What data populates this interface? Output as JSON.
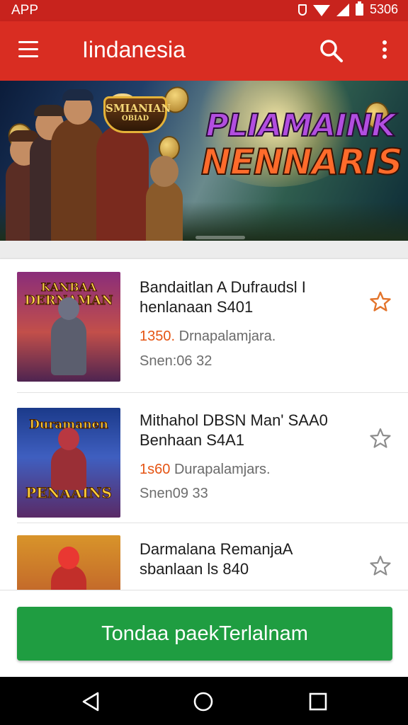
{
  "status_bar": {
    "app_label": "APP",
    "time": "5306"
  },
  "app_bar": {
    "title": "Iindanesia",
    "menu_icon": "hamburger-menu-icon",
    "search_icon": "search-icon",
    "more_icon": "more-vert-icon"
  },
  "banner": {
    "logo_line1": "SMIANIAN",
    "logo_line2": "OBIAD",
    "title_line1": "PLIAMAINK",
    "title_line2": "NENNARIS"
  },
  "items": [
    {
      "thumb_line1": "KANBAA",
      "thumb_line2": "DERNAMAN",
      "name_line1": "Bandaitlan A Dufraudsl I",
      "name_line2": "henlanaan S401",
      "price": "1350.",
      "desc": "Drnapalamjara.",
      "size": "Snen:06 32",
      "star": "outline-orange",
      "accent": "#e55413"
    },
    {
      "thumb_line1": "Duramanen",
      "thumb_line2": "PENAAINS",
      "name_line1": "Mithahol DBSN Man' SAA0",
      "name_line2": "Benhaan S4A1",
      "price": "1s60",
      "desc": "Durapalamjars.",
      "size": "Snen09 33",
      "star": "outline-grey",
      "accent": "#e55413"
    },
    {
      "thumb_line1": "",
      "thumb_line2": "",
      "name_line1": "Darmalana RemanjaA",
      "name_line2": "sbanlaan ls 840",
      "price": "",
      "desc": "",
      "size": "",
      "star": "outline-grey",
      "accent": "#e55413"
    }
  ],
  "cta": {
    "label": "Tondaa paekTerlalnam"
  },
  "nav": {
    "back_icon": "back-triangle-icon",
    "home_icon": "home-circle-icon",
    "recents_icon": "recents-square-icon"
  }
}
